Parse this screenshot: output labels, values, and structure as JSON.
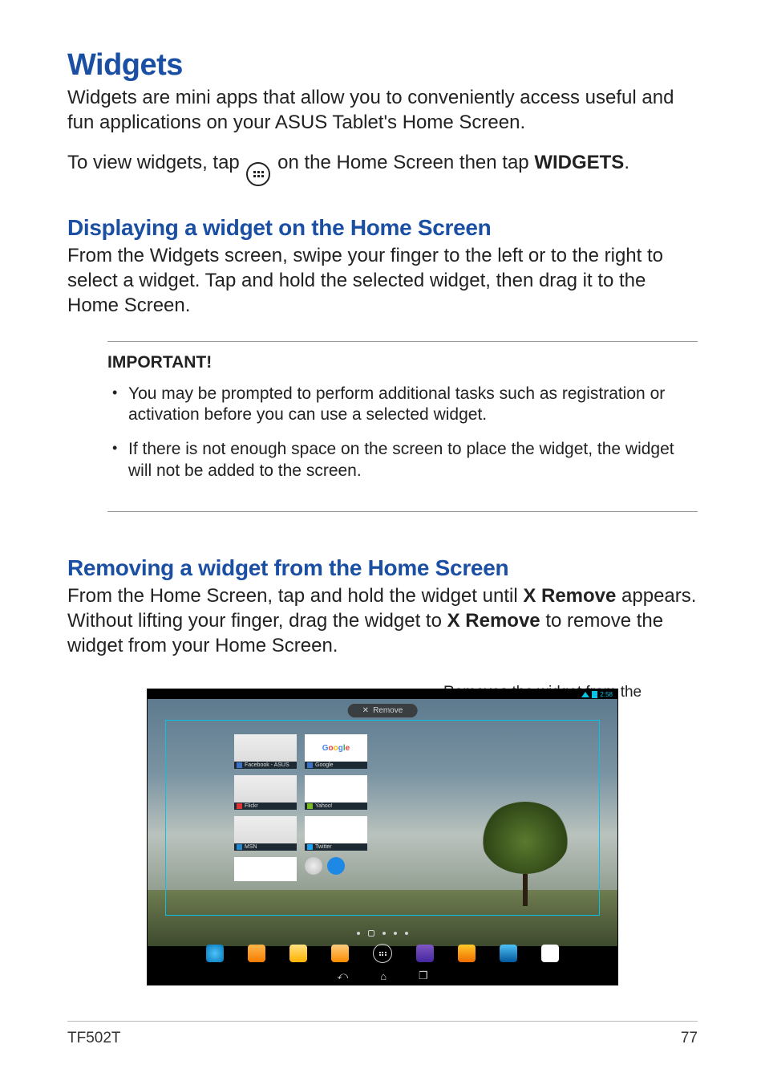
{
  "heading": "Widgets",
  "intro": "Widgets are mini apps that allow you to conveniently access useful and fun applications on your ASUS Tablet's Home Screen.",
  "view_line_pre": "To view widgets, tap ",
  "view_line_post_a": " on the Home Screen then tap ",
  "view_line_bold": "WIDGETS",
  "view_line_end": ".",
  "sub1_title": "Displaying a widget on the Home Screen",
  "sub1_body": "From the Widgets screen, swipe your finger to the left or to the right to select a widget. Tap and hold the selected widget, then drag it to the Home Screen.",
  "important_label": "IMPORTANT!",
  "important_items": [
    "You may be prompted to perform additional tasks such as registration or activation before you can use a selected widget.",
    "If there is not enough space on the screen to place the widget, the widget will not be added to the screen."
  ],
  "sub2_title": "Removing a widget from the Home Screen",
  "sub2_body_a": "From the Home Screen, tap and hold the widget until ",
  "sub2_bold1": "X Remove",
  "sub2_body_b": " appears. Without lifting your finger, drag the widget to ",
  "sub2_bold2": "X Remove",
  "sub2_body_c": " to remove the widget from your Home Screen.",
  "callout": "Removes the widget from the Home Screen",
  "tablet": {
    "remove_label": "Remove",
    "time": "2:58",
    "widgets": {
      "r1c1": "Facebook - ASUS",
      "r1c2": "Google",
      "r2c1": "Flickr",
      "r2c2": "Yahoo!",
      "r3c1": "MSN",
      "r3c2": "Twitter"
    }
  },
  "footer_model": "TF502T",
  "footer_page": "77"
}
